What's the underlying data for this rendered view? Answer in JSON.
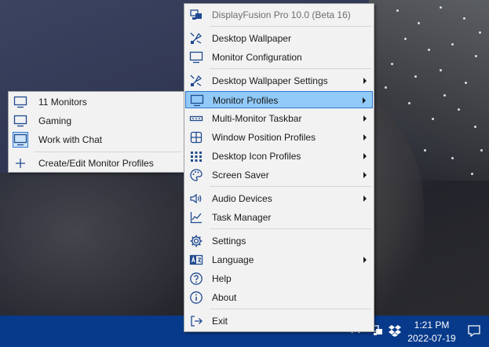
{
  "menu": {
    "header": "DisplayFusion Pro 10.0 (Beta 16)",
    "items": [
      {
        "label": "Desktop Wallpaper",
        "icon": "wallpaper-icon",
        "submenu": false
      },
      {
        "label": "Monitor Configuration",
        "icon": "monitor-icon",
        "submenu": false
      },
      {
        "label": "Desktop Wallpaper Settings",
        "icon": "wallpaper-icon",
        "submenu": true
      },
      {
        "label": "Monitor Profiles",
        "icon": "monitor-icon",
        "submenu": true,
        "highlighted": true
      },
      {
        "label": "Multi-Monitor Taskbar",
        "icon": "taskbar-icon",
        "submenu": true
      },
      {
        "label": "Window Position Profiles",
        "icon": "window-grid-icon",
        "submenu": true
      },
      {
        "label": "Desktop Icon Profiles",
        "icon": "icon-grid-icon",
        "submenu": true
      },
      {
        "label": "Screen Saver",
        "icon": "palette-icon",
        "submenu": true
      },
      {
        "label": "Audio Devices",
        "icon": "speaker-icon",
        "submenu": true
      },
      {
        "label": "Task Manager",
        "icon": "chart-line-icon",
        "submenu": false
      },
      {
        "label": "Settings",
        "icon": "gear-icon",
        "submenu": false
      },
      {
        "label": "Language",
        "icon": "language-icon",
        "submenu": true
      },
      {
        "label": "Help",
        "icon": "help-icon",
        "submenu": false
      },
      {
        "label": "About",
        "icon": "info-icon",
        "submenu": false
      },
      {
        "label": "Exit",
        "icon": "exit-icon",
        "submenu": false
      }
    ]
  },
  "submenu": {
    "items": [
      {
        "label": "11 Monitors",
        "icon": "monitor-icon"
      },
      {
        "label": "Gaming",
        "icon": "monitor-icon"
      },
      {
        "label": "Work with Chat",
        "icon": "monitor-icon",
        "selected": true
      },
      {
        "label": "Create/Edit Monitor Profiles",
        "icon": "plus-icon"
      }
    ]
  },
  "taskbar": {
    "time": "1:21 PM",
    "date": "2022-07-19"
  },
  "colors": {
    "taskbar": "#073a8a",
    "highlight": "#91c9f7",
    "highlight_border": "#2e78d2",
    "icon": "#1f4a8f"
  }
}
